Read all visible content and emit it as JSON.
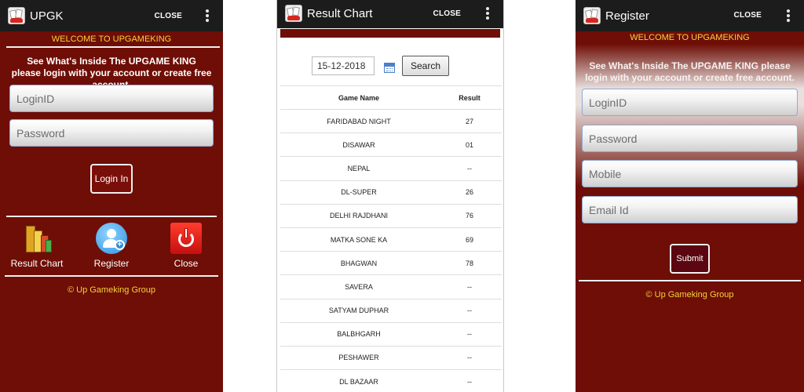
{
  "login_screen": {
    "app_title": "UPGK",
    "close_label": "CLOSE",
    "welcome": "WELCOME TO UPGAMEKING",
    "intro": "See What's Inside The UPGAME KING please login with your account or create free account.",
    "loginid_placeholder": "LoginID",
    "password_placeholder": "Password",
    "login_button": "Login In",
    "menu": [
      {
        "label": "Result Chart",
        "icon": "chart-icon"
      },
      {
        "label": "Register",
        "icon": "add-user-icon"
      },
      {
        "label": "Close",
        "icon": "power-icon"
      }
    ],
    "footer": "© Up Gameking Group"
  },
  "result_screen": {
    "app_title": "Result Chart",
    "close_label": "CLOSE",
    "date_value": "15-12-2018",
    "search_label": "Search",
    "headers": {
      "game": "Game Name",
      "result": "Result"
    },
    "rows": [
      {
        "game": "FARIDABAD NIGHT",
        "result": "27"
      },
      {
        "game": "DISAWAR",
        "result": "01"
      },
      {
        "game": "NEPAL",
        "result": "--"
      },
      {
        "game": "DL-SUPER",
        "result": "26"
      },
      {
        "game": "DELHI RAJDHANI",
        "result": "76"
      },
      {
        "game": "MATKA SONE KA",
        "result": "69"
      },
      {
        "game": "BHAGWAN",
        "result": "78"
      },
      {
        "game": "SAVERA",
        "result": "--"
      },
      {
        "game": "SATYAM DUPHAR",
        "result": "--"
      },
      {
        "game": "BALBHGARH",
        "result": "--"
      },
      {
        "game": "PESHAWER",
        "result": "--"
      },
      {
        "game": "DL BAZAAR",
        "result": "--"
      }
    ]
  },
  "register_screen": {
    "app_title": "Register",
    "close_label": "CLOSE",
    "welcome": "WELCOME TO UPGAMEKING",
    "intro": "See What's Inside The UPGAME KING please login with your account or create free account.",
    "loginid_placeholder": "LoginID",
    "password_placeholder": "Password",
    "mobile_placeholder": "Mobile",
    "email_placeholder": "Email Id",
    "submit_button": "Submit",
    "footer": "© Up Gameking Group"
  },
  "colors": {
    "brand_maroon": "#6e0e06",
    "accent_yellow": "#f5d33a",
    "appbar": "#1c1c1c"
  }
}
